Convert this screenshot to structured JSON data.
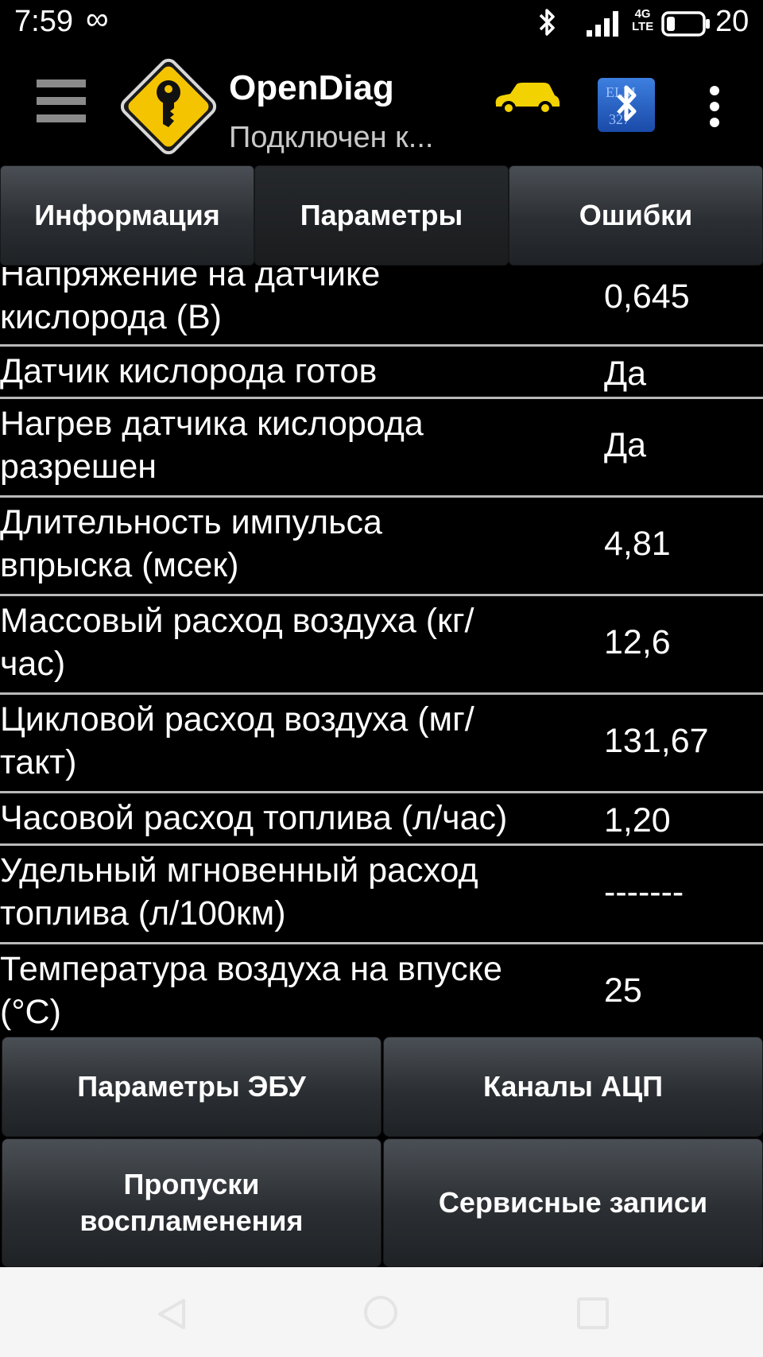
{
  "status_bar": {
    "time": "7:59",
    "loop_glyph": "∞",
    "network_top": "4G",
    "network_bottom": "LTE",
    "battery": "20"
  },
  "app_bar": {
    "title": "OpenDiag",
    "subtitle": "Подключен к...",
    "icons": [
      "menu-icon",
      "key-logo-icon",
      "car-icon",
      "bluetooth-elm327-icon",
      "overflow-menu-icon"
    ],
    "car_color": "#f2d200"
  },
  "tabs": [
    {
      "label": "Информация",
      "active": false
    },
    {
      "label": "Параметры",
      "active": true
    },
    {
      "label": "Ошибки",
      "active": false
    }
  ],
  "parameters": [
    {
      "label_lines": [
        "Напряжение на датчике",
        "кислорода (В)"
      ],
      "value": "0,645"
    },
    {
      "label_lines": [
        "Датчик кислорода готов"
      ],
      "value": "Да"
    },
    {
      "label_lines": [
        "Нагрев датчика кислорода",
        "разрешен"
      ],
      "value": "Да"
    },
    {
      "label_lines": [
        "Длительность импульса",
        "впрыска (мсек)"
      ],
      "value": "4,81"
    },
    {
      "label_lines": [
        "Массовый расход воздуха (кг/",
        "час)"
      ],
      "value": "12,6"
    },
    {
      "label_lines": [
        "Цикловой расход воздуха (мг/",
        "такт)"
      ],
      "value": "131,67"
    },
    {
      "label_lines": [
        "Часовой расход топлива (л/час)"
      ],
      "value": "1,20"
    },
    {
      "label_lines": [
        "Удельный мгновенный расход",
        "топлива (л/100км)"
      ],
      "value": "-------"
    },
    {
      "label_lines": [
        "Температура воздуха на впуске",
        "(°C)"
      ],
      "value": "25"
    }
  ],
  "bottom_buttons": {
    "ecu_params": "Параметры ЭБУ",
    "adc_channels": "Каналы АЦП",
    "misfire_line1": "Пропуски",
    "misfire_line2": "воспламенения",
    "service_records": "Сервисные записи"
  }
}
